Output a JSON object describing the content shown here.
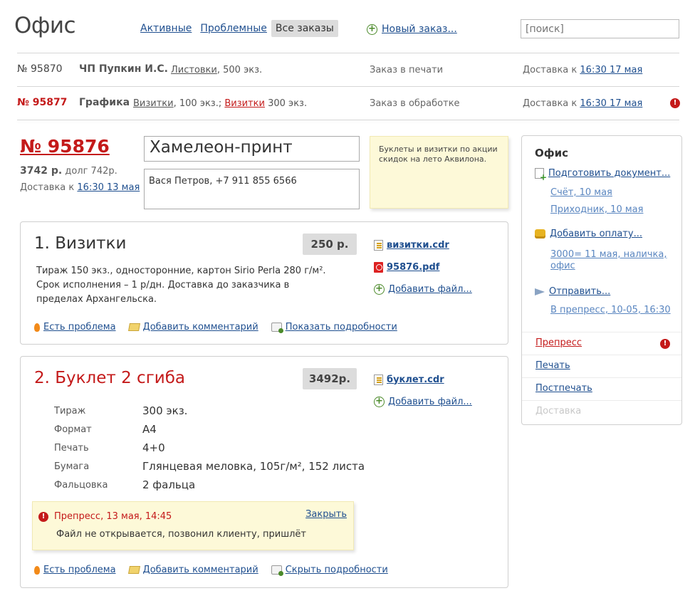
{
  "header": {
    "title": "Офис",
    "tabs": [
      {
        "label": "Активные"
      },
      {
        "label": "Проблемные"
      },
      {
        "label": "Все заказы"
      }
    ],
    "new_order": "Новый заказ...",
    "search_placeholder": "[поиск]"
  },
  "orders": [
    {
      "number": "№ 95870",
      "client": "ЧП Пупкин И.С.",
      "item1": "Листовки",
      "item1_rest": ", 500 экз.",
      "status": "Заказ в печати",
      "delivery_prefix": "Доставка к",
      "delivery_time": "16:30 17 мая"
    },
    {
      "number": "№ 95877",
      "client": "Графика",
      "item1": "Визитки",
      "item1_rest": ", 100 экз.;",
      "item2": "Визитки",
      "item2_rest": " 300 экз.",
      "status": "Заказ в обработке",
      "delivery_prefix": "Доставка к",
      "delivery_time": "16:30 17 мая"
    }
  ],
  "current": {
    "number": "№ 95876",
    "total": "3742 р.",
    "debt": "долг 742р.",
    "delivery_prefix": "Доставка к",
    "delivery_time": "16:30 13 мая",
    "client_name": "Хамелеон-принт",
    "client_contact": "Вася Петров, +7 911 855 6566",
    "note": "Буклеты и визитки по акции скидок на лето Аквилона."
  },
  "product1": {
    "title": "1. Визитки",
    "price": "250 р.",
    "description": "Тираж 150 экз., односторонние, картон Sirio Perla 280 г/м². Срок исполнения – 1 р/дн. Доставка до заказчика в пределах Архангельска.",
    "files": [
      "визитки.cdr",
      "95876.pdf"
    ],
    "add_file": "Добавить файл...",
    "actions": {
      "problem": "Есть проблема",
      "comment": "Добавить комментарий",
      "details": "Показать подробности"
    }
  },
  "product2": {
    "title": "2. Буклет 2 сгиба",
    "price": "3492р.",
    "files": [
      "буклет.cdr"
    ],
    "add_file": "Добавить файл...",
    "specs": [
      {
        "key": "Тираж",
        "value": "300 экз."
      },
      {
        "key": "Формат",
        "value": "А4"
      },
      {
        "key": "Печать",
        "value": "4+0"
      },
      {
        "key": "Бумага",
        "value": "Глянцевая меловка, 105г/м², 152 листа"
      },
      {
        "key": "Фальцовка",
        "value": "2 фальца"
      }
    ],
    "issue": {
      "title": "Препресс, 13 мая, 14:45",
      "text": "Файл не открывается, позвонил клиенту, пришлёт",
      "close": "Закрыть"
    },
    "actions": {
      "problem": "Есть проблема",
      "comment": "Добавить комментарий",
      "details": "Скрыть подробности"
    }
  },
  "sidebar": {
    "title": "Офис",
    "prepare_doc": "Подготовить документ...",
    "invoice": "Счёт, 10 мая",
    "receipt": "Приходник, 10 мая",
    "add_payment": "Добавить оплату...",
    "payment": "3000= 11 мая, наличка, офис",
    "send": "Отправить...",
    "sent": "В препресс, 10-05, 16:30",
    "stages": [
      {
        "label": "Препресс"
      },
      {
        "label": "Печать"
      },
      {
        "label": "Постпечать"
      },
      {
        "label": "Доставка"
      }
    ]
  }
}
